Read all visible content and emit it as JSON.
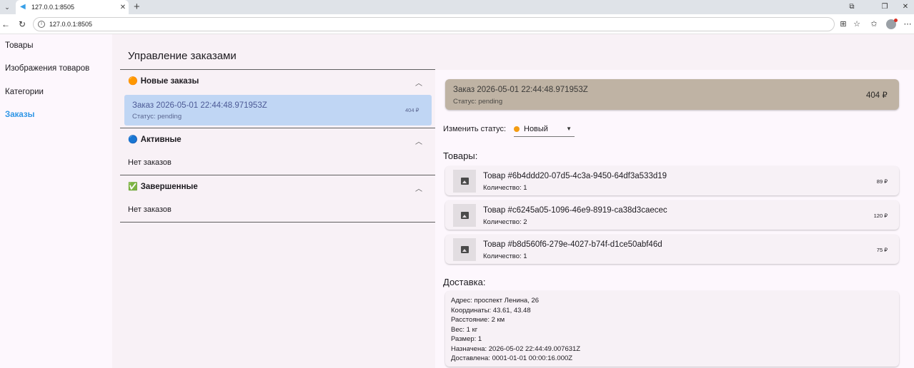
{
  "browser": {
    "tab_title": "127.0.0.1:8505",
    "url": "127.0.0.1:8505"
  },
  "sidebar": {
    "items": [
      {
        "label": "Товары"
      },
      {
        "label": "Изображения товаров"
      },
      {
        "label": "Категории"
      },
      {
        "label": "Заказы"
      }
    ]
  },
  "page": {
    "title": "Управление заказами"
  },
  "sections": {
    "new": {
      "icon": "🟠",
      "label": "Новые заказы"
    },
    "active": {
      "icon": "🔵",
      "label": "Активные",
      "empty": "Нет заказов"
    },
    "done": {
      "icon": "✅",
      "label": "Завершенные",
      "empty": "Нет заказов"
    }
  },
  "new_order": {
    "title": "Заказ 2026-05-01 22:44:48.971953Z",
    "status": "Статус: pending",
    "price": "404 ₽"
  },
  "detail": {
    "title": "Заказ 2026-05-01 22:44:48.971953Z",
    "status": "Статус: pending",
    "price": "404 ₽",
    "change_status_label": "Изменить статус:",
    "status_value": "Новый",
    "status_color": "#f39c12",
    "items_heading": "Товары:",
    "items": [
      {
        "name": "Товар #6b4ddd20-07d5-4c3a-9450-64df3a533d19",
        "qty": "Количество: 1",
        "price": "89 ₽"
      },
      {
        "name": "Товар #c6245a05-1096-46e9-8919-ca38d3caecec",
        "qty": "Количество: 2",
        "price": "120 ₽"
      },
      {
        "name": "Товар #b8d560f6-279e-4027-b74f-d1ce50abf46d",
        "qty": "Количество: 1",
        "price": "75 ₽"
      }
    ],
    "delivery_heading": "Доставка:",
    "delivery": [
      "Адрес: проспект Ленина, 26",
      "Координаты: 43.61, 43.48",
      "Расстояние: 2 км",
      "Вес: 1 кг",
      "Размер: 1",
      "Назначена: 2026-05-02 22:44:49.007631Z",
      "Доставлена: 0001-01-01 00:00:16.000Z"
    ]
  }
}
